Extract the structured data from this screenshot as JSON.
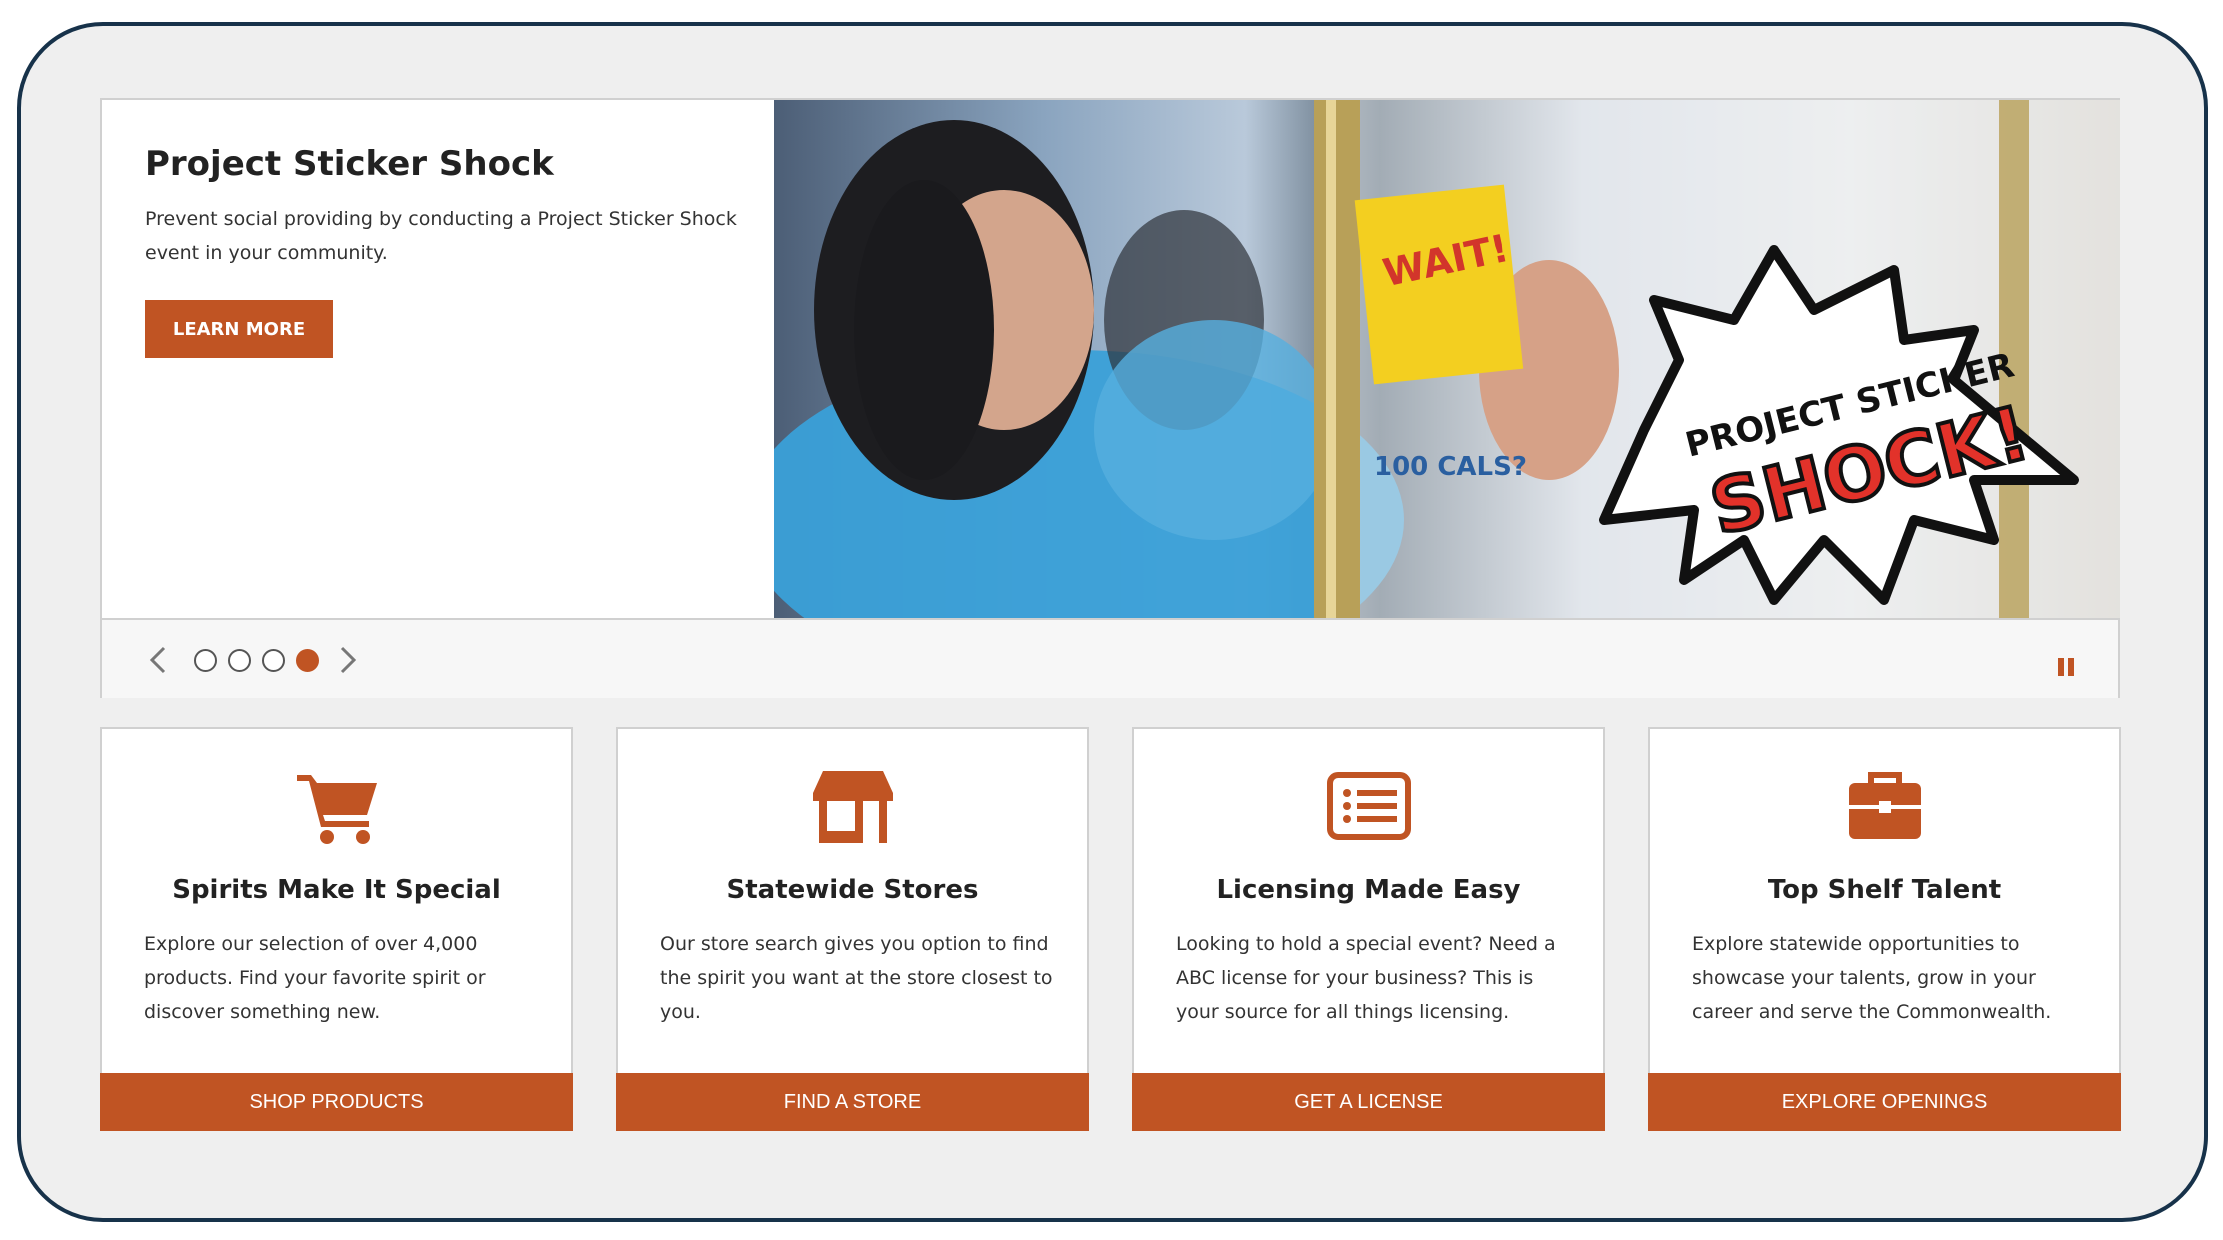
{
  "colors": {
    "accent": "#c05423",
    "frame": "#17324a",
    "background": "#efefef"
  },
  "carousel": {
    "title": "Project Sticker Shock",
    "description": "Prevent social providing by conducting a Project Sticker Shock event in your community.",
    "button_label": "LEARN MORE",
    "image_text": {
      "wait": "WAIT!",
      "badge_line1": "PROJECT STICKER",
      "badge_line2": "SHOCK!",
      "cals": "100 CALS?"
    },
    "slide_count": 4,
    "active_slide": 4,
    "icons": {
      "prev": "chevron-left-icon",
      "next": "chevron-right-icon",
      "pause": "pause-icon"
    }
  },
  "cards": [
    {
      "icon": "shopping-cart-icon",
      "title": "Spirits Make It Special",
      "description": "Explore our selection of over 4,000 products. Find your favorite spirit or discover something new.",
      "button_label": "SHOP PRODUCTS"
    },
    {
      "icon": "store-icon",
      "title": "Statewide Stores",
      "description": "Our store search gives you option to find the spirit you want at the store closest to you.",
      "button_label": "FIND A STORE"
    },
    {
      "icon": "list-icon",
      "title": "Licensing Made Easy",
      "description": "Looking to hold a special event? Need a ABC license for your business? This is your source for all things licensing.",
      "button_label": "GET A LICENSE"
    },
    {
      "icon": "briefcase-icon",
      "title": "Top Shelf Talent",
      "description": "Explore statewide opportunities to showcase your talents, grow in your career and serve the Commonwealth.",
      "button_label": "EXPLORE OPENINGS"
    }
  ]
}
